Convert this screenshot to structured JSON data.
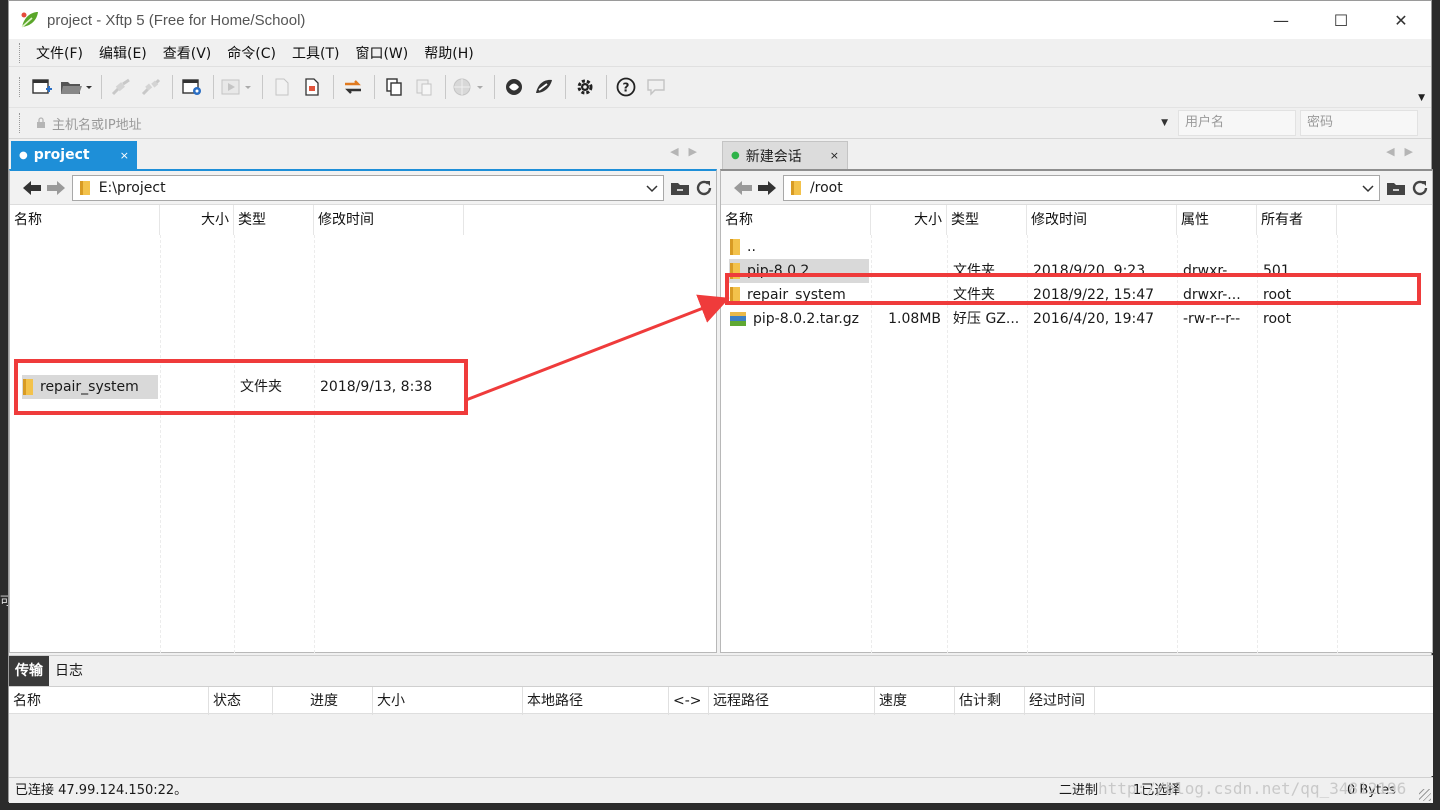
{
  "window": {
    "title": "project - Xftp 5 (Free for Home/School)",
    "controls": {
      "minimize": "—",
      "maximize": "☐",
      "close": "✕"
    }
  },
  "menu": [
    "文件(F)",
    "编辑(E)",
    "查看(V)",
    "命令(C)",
    "工具(T)",
    "窗口(W)",
    "帮助(H)"
  ],
  "toolbar": {
    "icons": [
      "new-session-icon",
      "open-folder-icon",
      "connect-icon",
      "disconnect-icon",
      "session-properties-icon",
      "transfer-start-icon",
      "new-file-icon",
      "new-text-file-icon",
      "sync-arrows-icon",
      "copy-icon",
      "paste-icon",
      "globe-icon",
      "xshell-icon",
      "xmanager-icon",
      "settings-gear-icon",
      "help-icon",
      "chat-icon"
    ]
  },
  "address": {
    "host_placeholder": "主机名或IP地址",
    "user_placeholder": "用户名",
    "password_placeholder": "密码"
  },
  "left_pane": {
    "tab_label": "project",
    "tab_close": "×",
    "path": "E:\\project",
    "columns": [
      "名称",
      "大小",
      "类型",
      "修改时间"
    ],
    "files": [
      {
        "name": "repair_system",
        "size": "",
        "type": "文件夹",
        "modified": "2018/9/13, 8:38",
        "icon": "folder-icon"
      }
    ]
  },
  "right_pane": {
    "tab_label": "新建会话",
    "tab_close": "×",
    "path": "/root",
    "columns": [
      "名称",
      "大小",
      "类型",
      "修改时间",
      "属性",
      "所有者"
    ],
    "files": [
      {
        "name": "..",
        "size": "",
        "type": "",
        "modified": "",
        "attr": "",
        "owner": "",
        "icon": "folder-icon"
      },
      {
        "name": "pip-8.0.2",
        "size": "",
        "type": "文件夹",
        "modified": "2018/9/20, 9:23",
        "attr": "drwxr-...",
        "owner": "501",
        "icon": "folder-icon"
      },
      {
        "name": "repair_system",
        "size": "",
        "type": "文件夹",
        "modified": "2018/9/22, 15:47",
        "attr": "drwxr-...",
        "owner": "root",
        "icon": "folder-icon"
      },
      {
        "name": "pip-8.0.2.tar.gz",
        "size": "1.08MB",
        "type": "好压 GZ...",
        "modified": "2016/4/20, 19:47",
        "attr": "-rw-r--r--",
        "owner": "root",
        "icon": "archive-icon"
      }
    ]
  },
  "transfer": {
    "tabs": [
      "传输",
      "日志"
    ],
    "columns": [
      "名称",
      "状态",
      "进度",
      "大小",
      "本地路径",
      "<->",
      "远程路径",
      "速度",
      "估计剩",
      "经过时间"
    ]
  },
  "status": {
    "connection": "已连接 47.99.124.150:22。",
    "mode": "二进制",
    "selection": "1已选择",
    "bytes": "0 Bytes"
  },
  "watermark": "http://blog.csdn.net/qq_34812196",
  "colors": {
    "accent": "#1e8fd8",
    "highlight_red": "#ef3b3b",
    "connected_dot": "#2fb34a",
    "folder_yellow": "#f3c24b"
  }
}
